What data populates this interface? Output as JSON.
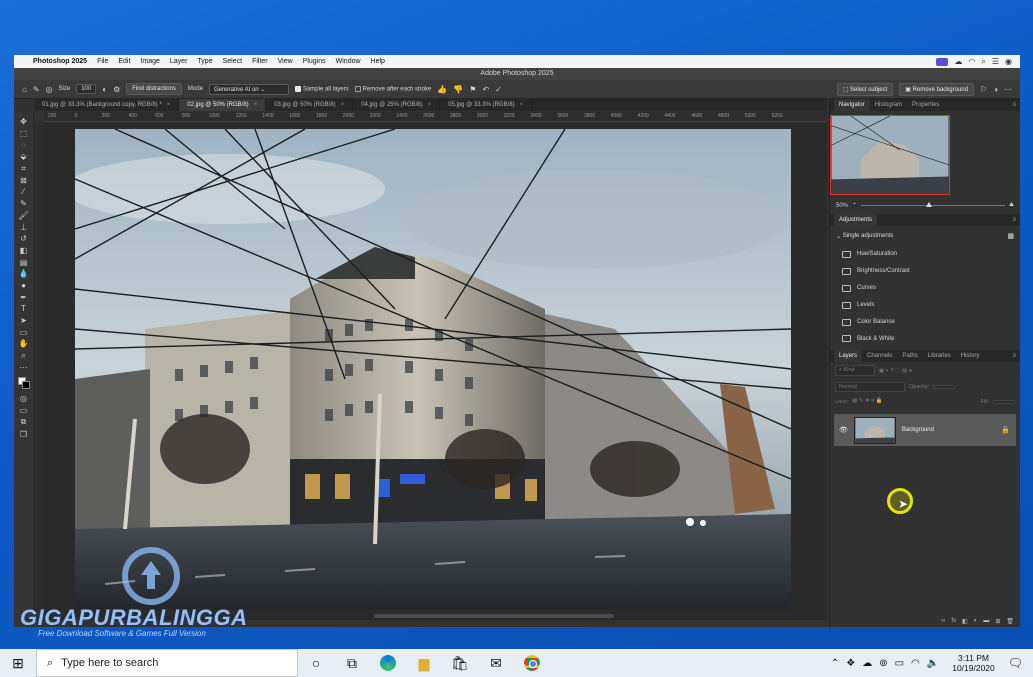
{
  "menubar": {
    "app": "Photoshop 2025",
    "items": [
      "File",
      "Edit",
      "Image",
      "Layer",
      "Type",
      "Select",
      "Filter",
      "View",
      "Plugins",
      "Window",
      "Help"
    ]
  },
  "window_title": "Adobe Photoshop 2025",
  "options": {
    "size_label": "Size",
    "size_value": "100",
    "find_distractions": "Find distractions",
    "mode_label": "Mode",
    "mode_value": "Generative AI on",
    "sample_all_layers": "Sample all layers",
    "remove_after_stroke": "Remove after each stroke",
    "select_subject": "Select subject",
    "remove_background": "Remove background"
  },
  "doc_tabs": [
    {
      "label": "01.jpg @ 33.3% (Background copy, RGB/8) *"
    },
    {
      "label": "02.jpg @ 50% (RGB/8)"
    },
    {
      "label": "03.jpg @ 50% (RGB/8)"
    },
    {
      "label": "04.jpg @ 25% (RGB/8)"
    },
    {
      "label": "05.jpg @ 33.3% (RGB/8)"
    }
  ],
  "ruler_ticks": [
    "200",
    "0",
    "200",
    "400",
    "600",
    "800",
    "1000",
    "1200",
    "1400",
    "1600",
    "1800",
    "2000",
    "2200",
    "2400",
    "2600",
    "2800",
    "3000",
    "3200",
    "3400",
    "3600",
    "3800",
    "4000",
    "4200",
    "4400",
    "4600",
    "4800",
    "5000",
    "5200"
  ],
  "panels": {
    "top_tabs": [
      "Navigator",
      "Histogram",
      "Properties"
    ],
    "zoom": "50%",
    "adjustments_title": "Adjustments",
    "single_adjustments": "Single adjustments",
    "adjustment_items": [
      "Hue/Saturation",
      "Brightness/Contrast",
      "Curves",
      "Levels",
      "Color Balance",
      "Black & White"
    ],
    "layer_tabs": [
      "Layers",
      "Channels",
      "Paths",
      "Libraries",
      "History"
    ],
    "kind": "Kind",
    "blend": "Normal",
    "opacity_label": "Opacity:",
    "lock_label": "Lock:",
    "fill_label": "Fill:",
    "layer_name": "Background"
  },
  "watermark": {
    "title": "GIGAPURBALINGGA",
    "tagline": "Free Download Software & Games Full Version"
  },
  "taskbar": {
    "search_placeholder": "Type here to search",
    "time": "3:11 PM",
    "date": "10/19/2020"
  },
  "colors": {
    "ps_bg": "#323232",
    "desktop": "#0d5bc6",
    "cursor_highlight": "#e6e600"
  }
}
